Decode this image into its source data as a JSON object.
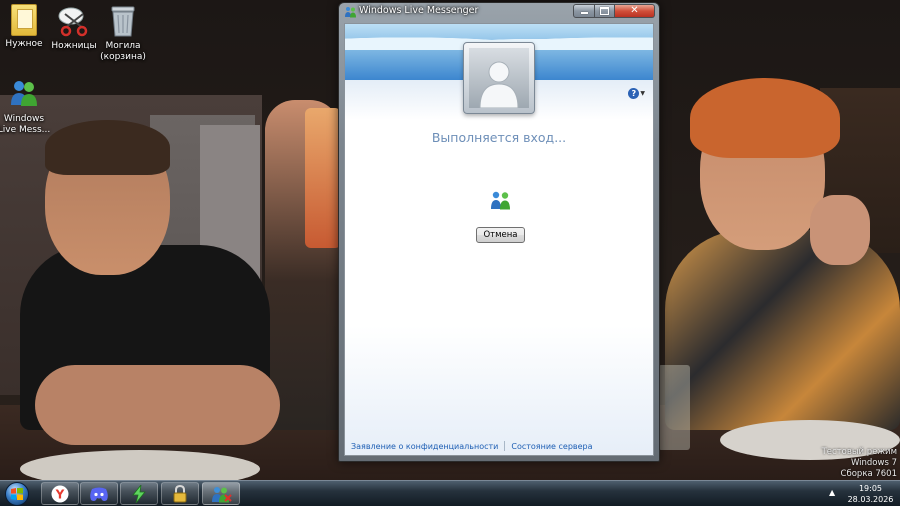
{
  "desktop": {
    "icons": [
      {
        "label": "Нужное",
        "icon": "folder-icon"
      },
      {
        "label": "Ножницы",
        "icon": "scissors-icon"
      },
      {
        "label": "Могила\n(корзина)",
        "label_line1": "Могила",
        "label_line2": "(корзина)",
        "icon": "recycle-bin-icon"
      },
      {
        "label_line1": "Windows",
        "label_line2": "Live Mess...",
        "icon": "windows-live-messenger-icon"
      }
    ]
  },
  "window": {
    "title": "Windows Live Messenger",
    "controls": {
      "minimize": "minimize",
      "maximize": "maximize",
      "close": "close"
    },
    "status_text": "Выполняется вход...",
    "cancel_label": "Отмена",
    "help_symbol": "?",
    "footer": {
      "privacy_link": "Заявление о конфиденциальности",
      "server_status_link": "Состояние сервера"
    }
  },
  "watermark": {
    "line1": "Тестовый режим",
    "line2": "Windows 7",
    "line3": "Сборка 7601"
  },
  "taskbar": {
    "pinned": [
      {
        "name": "yandex-browser-icon",
        "color": "#e83a2f"
      },
      {
        "name": "discord-icon",
        "color": "#5865f2"
      },
      {
        "name": "lightning-app-icon",
        "color": "#5ed45e"
      },
      {
        "name": "lock-app-icon",
        "color": "#e5b93c"
      },
      {
        "name": "messenger-taskbar-icon",
        "color": "#3e8fd8",
        "active": true
      }
    ],
    "tray_arrow": "▲",
    "time": "19:05",
    "date": "28.03.2026"
  },
  "colors": {
    "status_text": "#6e8fb8",
    "link": "#1e5fb4",
    "close_button": "#d1503a"
  }
}
